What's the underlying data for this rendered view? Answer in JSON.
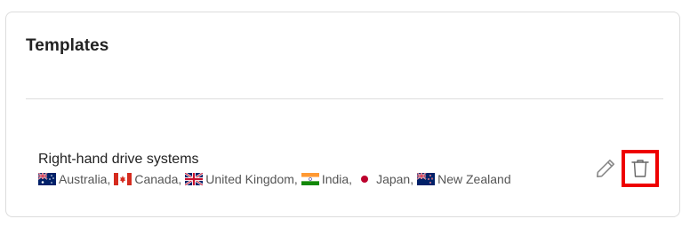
{
  "card": {
    "title": "Templates"
  },
  "template": {
    "name": "Right-hand drive systems",
    "countries": [
      {
        "name": "Australia",
        "separator": ",",
        "flag_icon": "flag-australia-icon"
      },
      {
        "name": "Canada",
        "separator": ",",
        "flag_icon": "flag-canada-icon"
      },
      {
        "name": "United Kingdom",
        "separator": ",",
        "flag_icon": "flag-uk-icon"
      },
      {
        "name": "India",
        "separator": ",",
        "flag_icon": "flag-india-icon"
      },
      {
        "name": "Japan",
        "separator": ",",
        "flag_icon": "flag-japan-icon"
      },
      {
        "name": "New Zealand",
        "separator": "",
        "flag_icon": "flag-new-zealand-icon"
      }
    ]
  },
  "actions": {
    "edit_icon": "pencil-icon",
    "delete_icon": "trash-icon",
    "highlight_color": "#ee0000"
  },
  "colors": {
    "border": "#dcdcdc",
    "text_primary": "#222222",
    "text_secondary": "#555555"
  }
}
